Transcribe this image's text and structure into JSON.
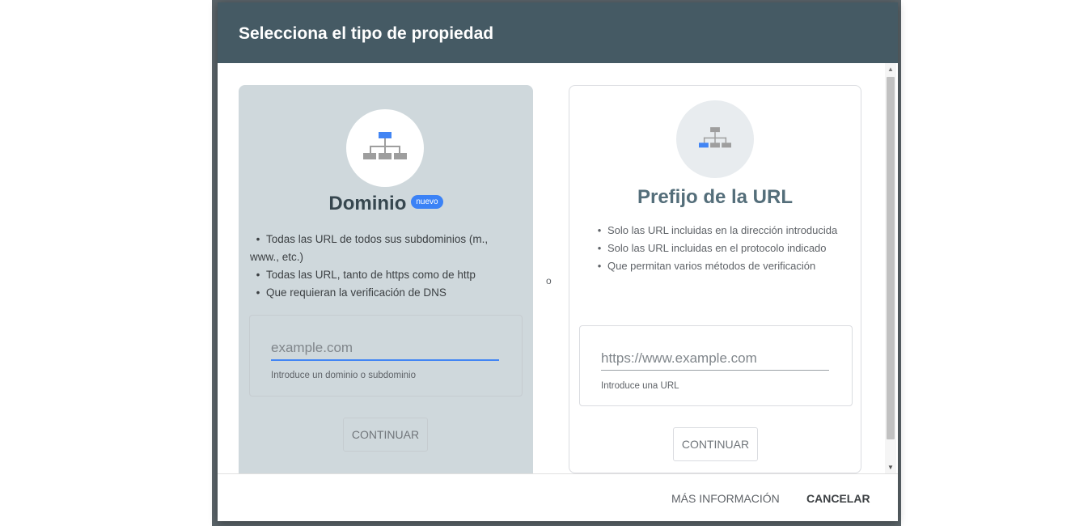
{
  "dialog": {
    "title": "Selecciona el tipo de propiedad"
  },
  "domain_card": {
    "title": "Dominio",
    "badge": "nuevo",
    "icon": "sitemap-icon",
    "bullets": [
      "Todas las URL de todos sus subdominios (m., www., etc.)",
      "Todas las URL, tanto de https como de http",
      "Que requieran la verificación de DNS"
    ],
    "input_placeholder": "example.com",
    "input_value": "",
    "helper_text": "Introduce un dominio o subdominio",
    "continue_label": "CONTINUAR"
  },
  "separator": "o",
  "url_card": {
    "title": "Prefijo de la URL",
    "icon": "sitemap-icon",
    "bullets": [
      "Solo las URL incluidas en la dirección introducida",
      "Solo las URL incluidas en el protocolo indicado",
      "Que permitan varios métodos de verificación"
    ],
    "input_placeholder": "https://www.example.com",
    "input_value": "",
    "helper_text": "Introduce una URL",
    "continue_label": "CONTINUAR"
  },
  "footer": {
    "more_info_label": "MÁS INFORMACIÓN",
    "cancel_label": "CANCELAR"
  },
  "colors": {
    "header_bg": "#455a64",
    "domain_card_bg": "#cfd8dc",
    "accent_blue": "#4285f4",
    "badge_blue": "#3b82f6"
  }
}
